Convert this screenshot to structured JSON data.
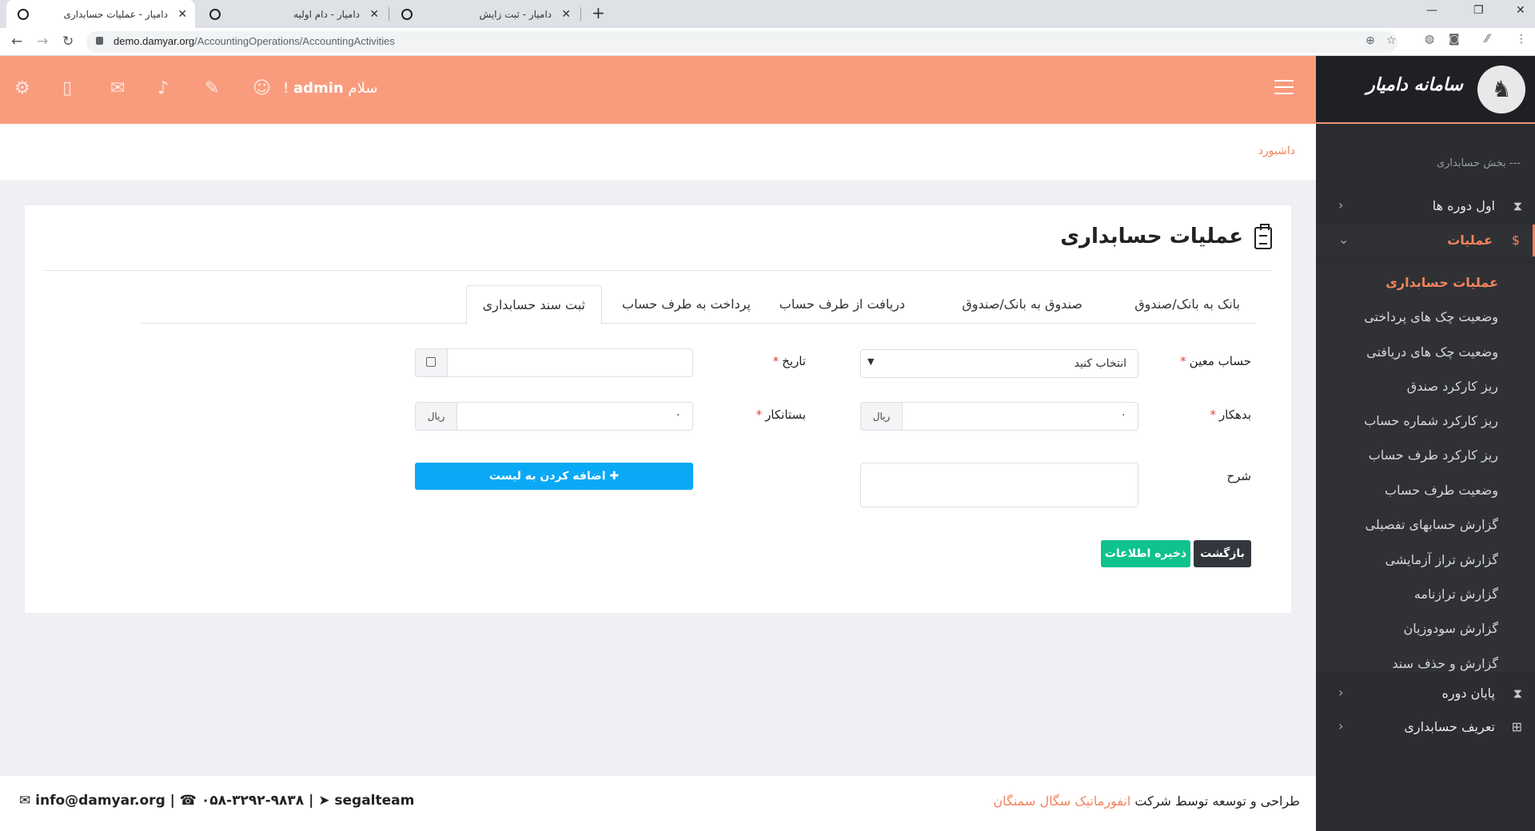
{
  "browser": {
    "tabs": [
      {
        "title": "دامیار - عملیات حسابداری",
        "active": true
      },
      {
        "title": "دامیار - دام اولیه",
        "active": false
      },
      {
        "title": "دامیار - ثبت زایش",
        "active": false
      }
    ],
    "url_host": "demo.damyar.org",
    "url_path": "/AccountingOperations/AccountingActivities"
  },
  "header": {
    "greeting_prefix": "سلام",
    "username": "admin",
    "greeting_sep": "!"
  },
  "breadcrumb": "داشبورد",
  "sidebar": {
    "brand": "سامانه دامیار",
    "section_title": "--- بخش حسابداری",
    "items": [
      {
        "label": "اول دوره ها",
        "icon": "hourglass-icon",
        "open": false
      },
      {
        "label": "عملیات",
        "icon": "money-icon",
        "open": true
      },
      {
        "label": "پایان دوره",
        "icon": "hourglass-end-icon",
        "open": false
      },
      {
        "label": "تعریف حسابداری",
        "icon": "plus-square-icon",
        "open": false
      }
    ],
    "submenu": [
      {
        "label": "عملیات حسابداری",
        "active": true
      },
      {
        "label": "وضعیت چک های پرداختی",
        "active": false
      },
      {
        "label": "وضعیت چک های دریافتی",
        "active": false
      },
      {
        "label": "ریز کارکرد صندق",
        "active": false
      },
      {
        "label": "ریز کارکرد شماره حساب",
        "active": false
      },
      {
        "label": "ریز کارکرد طرف حساب",
        "active": false
      },
      {
        "label": "وضعیت طرف حساب",
        "active": false
      },
      {
        "label": "گزارش حسابهای تفصیلی",
        "active": false
      },
      {
        "label": "گزارش تراز آزمایشی",
        "active": false
      },
      {
        "label": "گزارش ترازنامه",
        "active": false
      },
      {
        "label": "گزارش سودوزیان",
        "active": false
      },
      {
        "label": "گزارش و حذف سند",
        "active": false
      }
    ]
  },
  "page": {
    "title": "عملیات حسابداری",
    "tabs": [
      {
        "label": "بانک به بانک/صندوق"
      },
      {
        "label": "صندوق به بانک/صندوق"
      },
      {
        "label": "دریافت از طرف حساب"
      },
      {
        "label": "پرداخت به طرف حساب"
      },
      {
        "label": "ثبت سند حسابداری"
      }
    ],
    "form": {
      "account_label": "حساب معین",
      "account_value": "انتخاب کنید",
      "date_label": "تاریخ",
      "date_value": "",
      "debtor_label": "بدهکار",
      "debtor_value": "۰",
      "creditor_label": "بستانکار",
      "creditor_value": "۰",
      "currency": "ریال",
      "desc_label": "شرح",
      "desc_value": "",
      "required_mark": "*"
    },
    "buttons": {
      "add_to_list": "اضافه کردن به لیست",
      "back": "بازگشت",
      "save": "ذخیره اطلاعات"
    }
  },
  "footer": {
    "credit_prefix": "طراحی و توسعه توسط شرکت",
    "company": "انفورماتیک سگال سمنگان",
    "email": "info@damyar.org",
    "phone": "۰۵۸-۳۲۹۲-۹۸۳۸",
    "telegram": "segalteam",
    "sep": "|"
  },
  "colors": {
    "accent": "#f99c7d",
    "accent_text": "#f4835e",
    "sidebar_bg": "#2b2d31",
    "primary_btn": "#0aa9f5",
    "save_btn": "#10c28e",
    "back_btn": "#33373d"
  }
}
